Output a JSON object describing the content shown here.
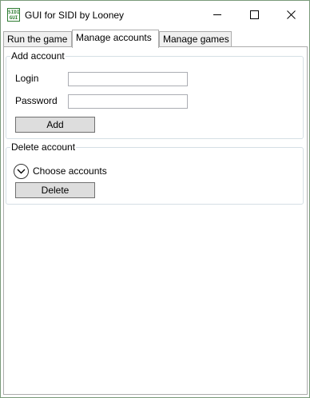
{
  "window": {
    "title": "GUI for SIDI by Looney",
    "icon_text_top": "SIDI",
    "icon_text_bottom": "GUI",
    "icon_color": "#2e7d32"
  },
  "tabs": [
    {
      "label": "Run the game",
      "active": false
    },
    {
      "label": "Manage accounts",
      "active": true
    },
    {
      "label": "Manage games",
      "active": false
    }
  ],
  "add_account": {
    "legend": "Add account",
    "login_label": "Login",
    "login_value": "",
    "password_label": "Password",
    "password_value": "",
    "add_button": "Add"
  },
  "delete_account": {
    "legend": "Delete account",
    "expander_label": "Choose accounts",
    "expander_icon": "chevron-down-icon",
    "delete_button": "Delete"
  }
}
